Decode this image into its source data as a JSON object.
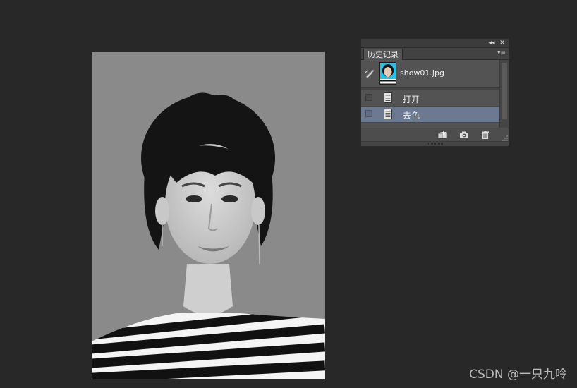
{
  "panel": {
    "collapse_glyph": "◂◂",
    "close_glyph": "✕",
    "tab_label": "历史记录",
    "menu_glyph": "▾≡",
    "snapshot": {
      "label": "show01.jpg",
      "icon": "history-brush-icon",
      "thumbnail_bg": "#28c2e8"
    },
    "states": [
      {
        "label": "打开",
        "selected": false,
        "icon": "document-state-icon"
      },
      {
        "label": "去色",
        "selected": true,
        "icon": "document-state-icon"
      }
    ],
    "bottom_buttons": [
      {
        "name": "new-document-from-state-icon"
      },
      {
        "name": "camera-snapshot-icon"
      },
      {
        "name": "trash-icon"
      }
    ],
    "selected_color": "#6b7a91"
  },
  "watermark": "CSDN @一只九呤"
}
